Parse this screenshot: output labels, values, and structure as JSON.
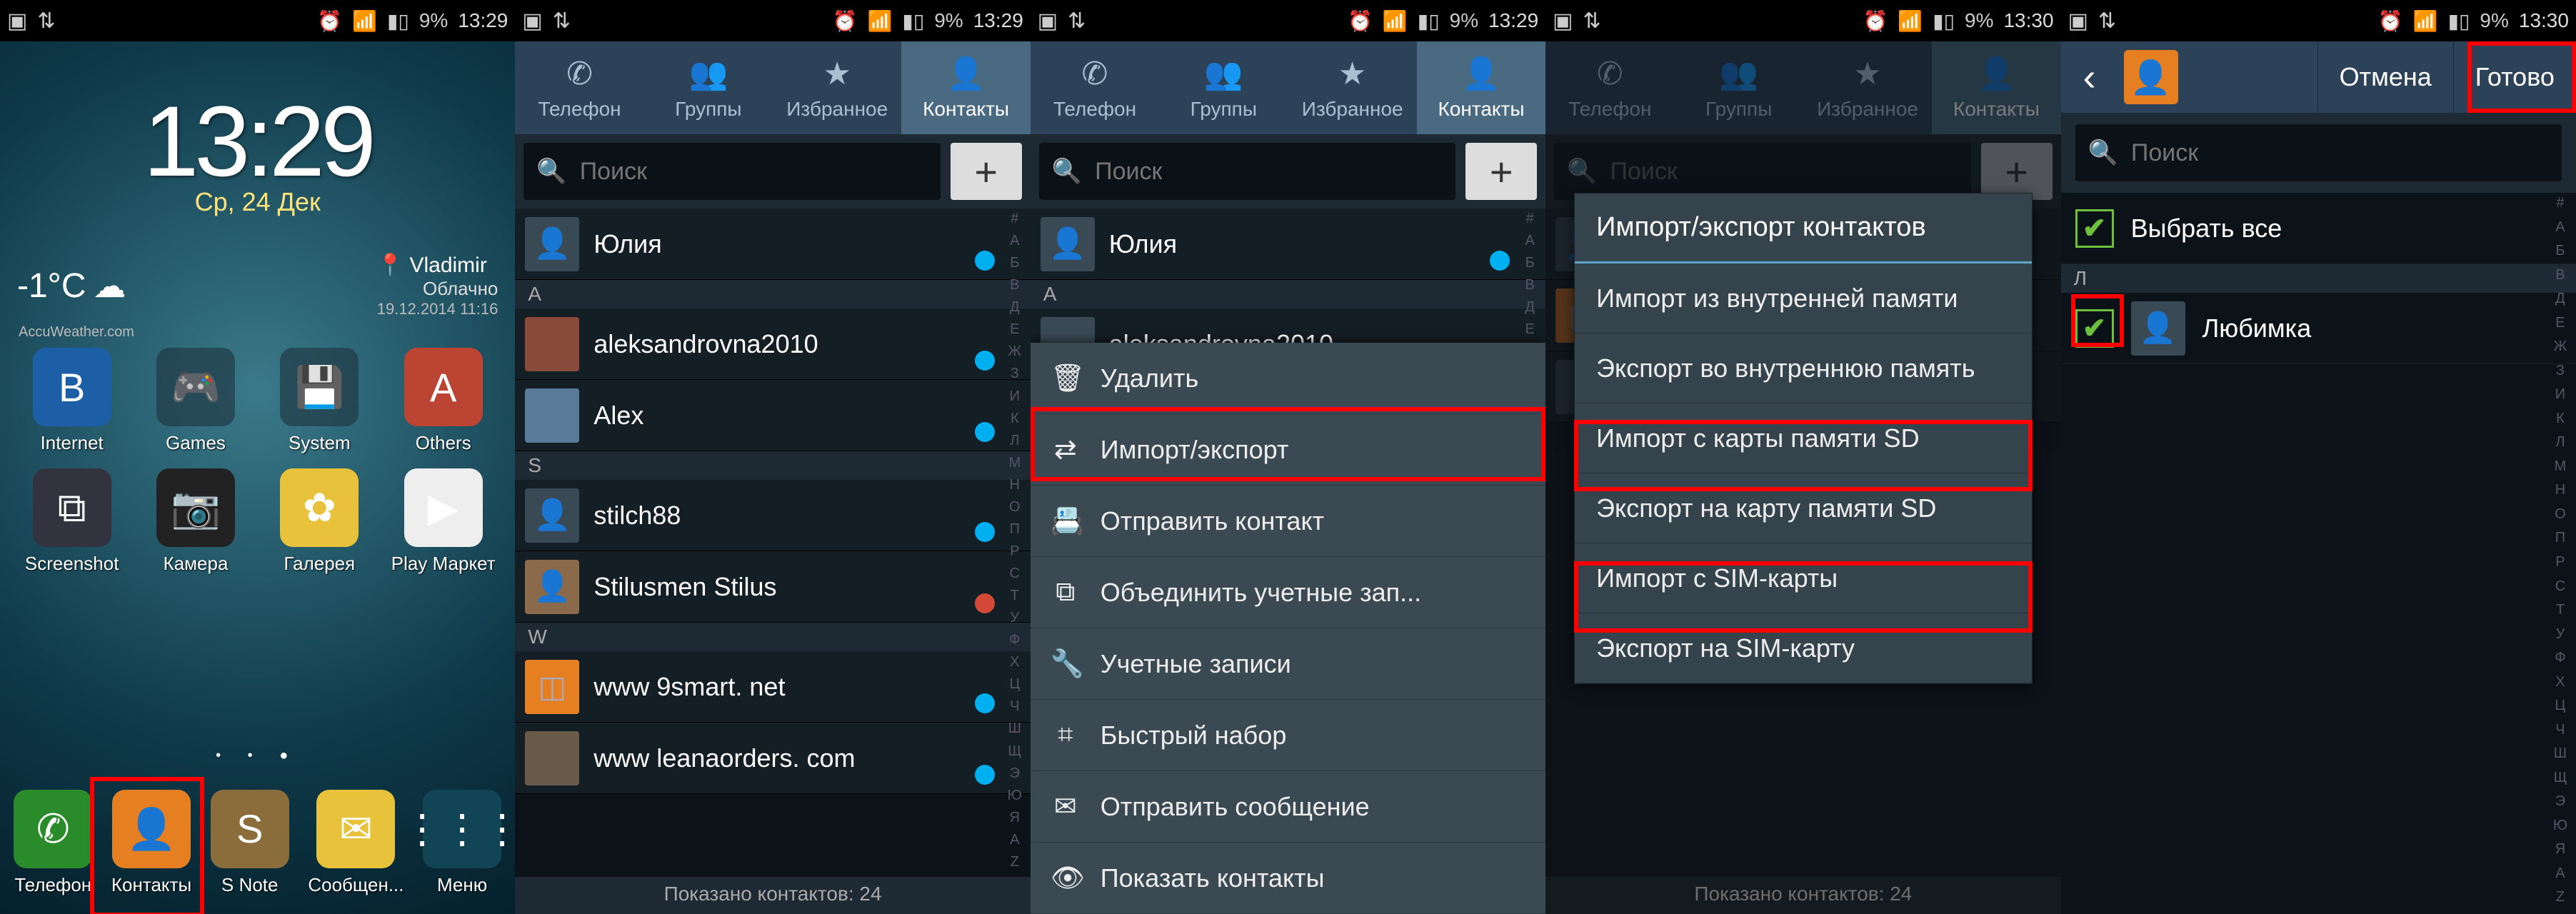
{
  "status": {
    "battery": "9%",
    "t0": "13:29",
    "t1": "13:29",
    "t2": "13:29",
    "t3": "13:30",
    "t4": "13:30"
  },
  "home": {
    "time": "13:29",
    "date": "Ср, 24 Дек",
    "temp": "-1°C",
    "provider": "AccuWeather.com",
    "city": "Vladimir",
    "cond": "Облачно",
    "updated": "19.12.2014 11:16",
    "apps_row1": [
      {
        "label": "Internet",
        "color": "c-blue",
        "glyph": "B"
      },
      {
        "label": "Games",
        "color": "c-folder",
        "glyph": "🎮"
      },
      {
        "label": "System",
        "color": "c-folder",
        "glyph": "💾"
      },
      {
        "label": "Others",
        "color": "c-red",
        "glyph": "A"
      }
    ],
    "apps_row2": [
      {
        "label": "Screenshot",
        "color": "c-dark",
        "glyph": "⧉"
      },
      {
        "label": "Камера",
        "color": "c-cam",
        "glyph": "📷"
      },
      {
        "label": "Галерея",
        "color": "c-gal",
        "glyph": "✿"
      },
      {
        "label": "Play Маркет",
        "color": "c-play",
        "glyph": "▶"
      }
    ],
    "dock": [
      {
        "label": "Телефон",
        "color": "c-green",
        "glyph": "✆"
      },
      {
        "label": "Контакты",
        "color": "c-orange",
        "glyph": "👤"
      },
      {
        "label": "S Note",
        "color": "c-brown",
        "glyph": "S"
      },
      {
        "label": "Сообщен...",
        "color": "c-yellow",
        "glyph": "✉"
      },
      {
        "label": "Меню",
        "color": "c-grid",
        "glyph": "⋮⋮⋮"
      }
    ]
  },
  "tabs": {
    "phone": "Телефон",
    "groups": "Группы",
    "fav": "Избранное",
    "contacts": "Контакты"
  },
  "search": {
    "placeholder": "Поиск",
    "add": "+"
  },
  "contacts": {
    "top_name": "Юлия",
    "section_a": "A",
    "section_s": "S",
    "section_w": "W",
    "list": [
      {
        "name": "aleksandrovna2010",
        "badge": "skype"
      },
      {
        "name": "Alex",
        "badge": "skype"
      },
      {
        "name": "stilch88",
        "badge": "skype"
      },
      {
        "name": "Stilusmen Stilus",
        "badge": "gplus"
      },
      {
        "name": "www 9smart. net",
        "badge": "skype"
      },
      {
        "name": "www leanaorders. com",
        "badge": "skype"
      }
    ],
    "footer": "Показано контактов: 24",
    "letters": [
      "#",
      "А",
      "Б",
      "В",
      "Д",
      "Е",
      "Ж",
      "З",
      "И",
      "К",
      "Л",
      "М",
      "Н",
      "О",
      "П",
      "Р",
      "С",
      "Т",
      "У",
      "Ф",
      "Х",
      "Ц",
      "Ч",
      "Ш",
      "Щ",
      "Э",
      "Ю",
      "Я",
      "A",
      "Z"
    ]
  },
  "menu": {
    "items": [
      {
        "icon": "🗑",
        "label": "Удалить"
      },
      {
        "icon": "⇄",
        "label": "Импорт/экспорт"
      },
      {
        "icon": "📇",
        "label": "Отправить контакт"
      },
      {
        "icon": "⧉",
        "label": "Объединить учетные зап..."
      },
      {
        "icon": "🔧",
        "label": "Учетные записи"
      },
      {
        "icon": "⌗",
        "label": "Быстрый набор"
      },
      {
        "icon": "✉",
        "label": "Отправить сообщение"
      },
      {
        "icon": "👁",
        "label": "Показать контакты"
      }
    ]
  },
  "dialog": {
    "title": "Импорт/экспорт контактов",
    "items": [
      "Импорт из внутренней памяти",
      "Экспорт во внутреннюю память",
      "Импорт с карты памяти SD",
      "Экспорт на карту памяти SD",
      "Импорт с SIM-карты",
      "Экспорт на SIM-карту"
    ]
  },
  "select": {
    "cancel": "Отмена",
    "done": "Готово",
    "select_all": "Выбрать все",
    "section": "Л",
    "item": "Любимка"
  }
}
